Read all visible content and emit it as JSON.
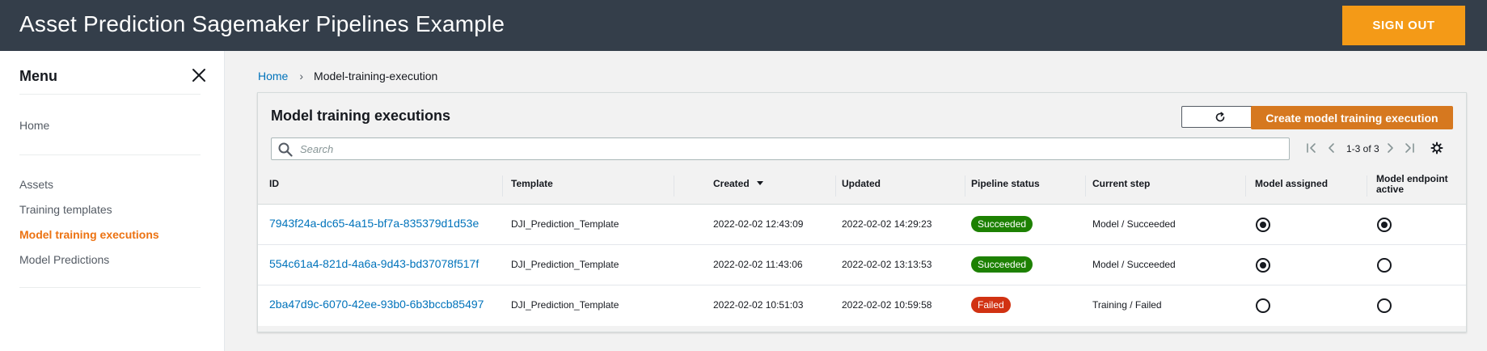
{
  "header": {
    "title": "Asset Prediction Sagemaker Pipelines Example",
    "sign_out_label": "SIGN OUT"
  },
  "sidebar": {
    "title": "Menu",
    "items": [
      {
        "label": "Home"
      },
      {
        "label": "Assets"
      },
      {
        "label": "Training templates"
      },
      {
        "label": "Model training executions",
        "active": true
      },
      {
        "label": "Model Predictions"
      }
    ]
  },
  "breadcrumb": {
    "home": "Home",
    "separator": "›",
    "current": "Model-training-execution"
  },
  "panel": {
    "title": "Model training executions",
    "create_label": "Create model training execution",
    "search_placeholder": "Search",
    "pagination": "1-3 of 3",
    "columns": {
      "id": "ID",
      "template": "Template",
      "created": "Created",
      "updated": "Updated",
      "pipeline_status": "Pipeline status",
      "current_step": "Current step",
      "model_assigned": "Model assigned",
      "model_endpoint_active_1": "Model endpoint",
      "model_endpoint_active_2": "active"
    },
    "rows": [
      {
        "id": "7943f24a-dc65-4a15-bf7a-835379d1d53e",
        "template": "DJI_Prediction_Template",
        "created": "2022-02-02 12:43:09",
        "updated": "2022-02-02 14:29:23",
        "status": "Succeeded",
        "current_step": "Model / Succeeded",
        "model_assigned": true,
        "endpoint_active": true
      },
      {
        "id": "554c61a4-821d-4a6a-9d43-bd37078f517f",
        "template": "DJI_Prediction_Template",
        "created": "2022-02-02 11:43:06",
        "updated": "2022-02-02 13:13:53",
        "status": "Succeeded",
        "current_step": "Model / Succeeded",
        "model_assigned": true,
        "endpoint_active": false
      },
      {
        "id": "2ba47d9c-6070-42ee-93b0-6b3bccb85497",
        "template": "DJI_Prediction_Template",
        "created": "2022-02-02 10:51:03",
        "updated": "2022-02-02 10:59:58",
        "status": "Failed",
        "current_step": "Training / Failed",
        "model_assigned": false,
        "endpoint_active": false
      }
    ]
  },
  "colors": {
    "topbar": "#343e4a",
    "sign_out": "#f49a17",
    "create_button": "#d6781f",
    "link": "#0073bb",
    "active_nav": "#ec7211",
    "succeeded": "#1d8102",
    "failed": "#d13212"
  },
  "icons": {
    "close": "close-icon",
    "refresh": "refresh-icon",
    "search": "search-icon",
    "first_page": "first-page-icon",
    "prev_page": "prev-page-icon",
    "next_page": "next-page-icon",
    "last_page": "last-page-icon",
    "settings": "gear-icon"
  }
}
